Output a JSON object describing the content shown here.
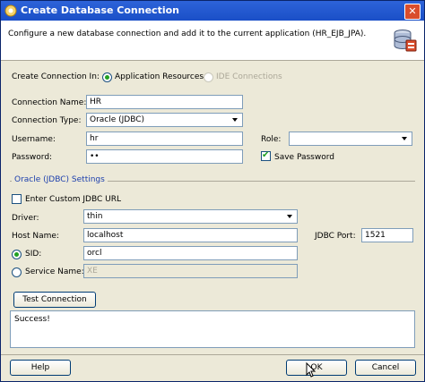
{
  "window": {
    "title": "Create Database Connection",
    "close_glyph": "✕"
  },
  "header": {
    "description": "Configure a new database connection and add it to the current application (HR_EJB_JPA)."
  },
  "create_in": {
    "label": "Create Connection In:",
    "option_app": "Application Resources",
    "option_ide": "IDE Connections"
  },
  "connection_name": {
    "label": "Connection Name:",
    "value": "HR"
  },
  "connection_type": {
    "label": "Connection Type:",
    "value": "Oracle (JDBC)"
  },
  "username": {
    "label": "Username:",
    "value": "hr"
  },
  "password": {
    "label": "Password:",
    "value": "••"
  },
  "role": {
    "label": "Role:",
    "value": ""
  },
  "save_password": {
    "label": "Save Password",
    "checked": true
  },
  "oracle_section": {
    "title": "Oracle (JDBC) Settings"
  },
  "custom_url": {
    "label": "Enter Custom JDBC URL",
    "checked": false
  },
  "driver": {
    "label": "Driver:",
    "value": "thin"
  },
  "host": {
    "label": "Host Name:",
    "value": "localhost"
  },
  "port": {
    "label": "JDBC Port:",
    "value": "1521"
  },
  "sid": {
    "label": "SID:",
    "value": "orcl"
  },
  "service": {
    "label": "Service Name:",
    "value": "XE"
  },
  "test_button": "Test Connection",
  "result_text": "Success!",
  "footer": {
    "help": "Help",
    "ok": "OK",
    "cancel": "Cancel"
  },
  "colors": {
    "title_bar": "#1a4fc7",
    "dialog_bg": "#ece9d8",
    "section_title": "#1c3fad"
  },
  "icons": {
    "title": "oracle-logo-icon",
    "header": "database-icon"
  }
}
